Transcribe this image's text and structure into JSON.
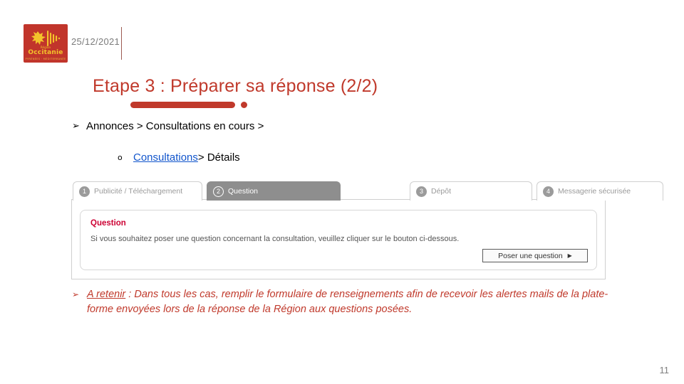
{
  "header": {
    "date": "25/12/2021",
    "logo": {
      "brand": "Occitanie",
      "supertext": "Région",
      "subtext": "PYRÉNÉES · MÉDITERRANÉE",
      "background_color": "#C1352B",
      "mark_color": "#F3C32B"
    }
  },
  "title": {
    "text": "Etape 3 : Préparer sa réponse (2/2)",
    "color": "#C0392B"
  },
  "breadcrumbs": [
    {
      "glyph": "➢",
      "text": "Annonces > Consultations en cours >"
    },
    {
      "glyph": "o",
      "link_text": "Consultations",
      "link_color": "#1155CC",
      "tail_text": "> Détails"
    }
  ],
  "screenshot": {
    "tabs": [
      {
        "number": "1",
        "label": "Publicité / Téléchargement",
        "active": false
      },
      {
        "number": "2",
        "label": "Question",
        "active": true
      },
      {
        "number": "3",
        "label": "Dépôt",
        "active": false
      },
      {
        "number": "4",
        "label": "Messagerie sécurisée",
        "active": false
      }
    ],
    "panel": {
      "heading": "Question",
      "heading_color": "#CC0033",
      "description": "Si vous souhaitez poser une question concernant la consultation, veuillez cliquer sur le bouton ci-dessous.",
      "button_label": "Poser une question",
      "button_arrow": "▶"
    }
  },
  "note": {
    "glyph": "➢",
    "lead": "A retenir",
    "body": " : Dans tous les cas, remplir le formulaire de renseignements afin de recevoir les alertes mails de la plate-forme envoyées lors de la réponse de la Région aux questions posées.",
    "color": "#C0392B"
  },
  "footer": {
    "page_number": "11"
  }
}
